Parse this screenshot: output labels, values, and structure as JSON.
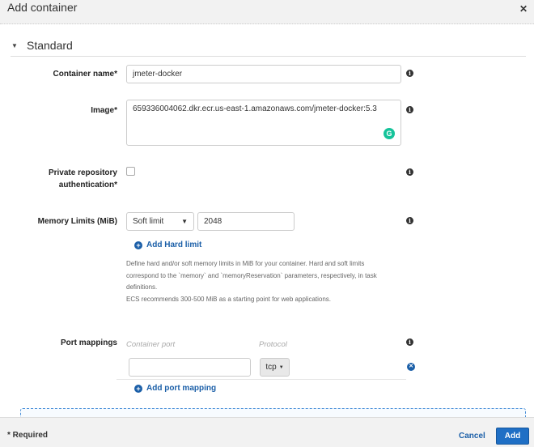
{
  "dialog": {
    "title": "Add container",
    "close_icon": "close-icon"
  },
  "section": {
    "title": "Standard"
  },
  "fields": {
    "container_name": {
      "label": "Container name*",
      "value": "jmeter-docker"
    },
    "image": {
      "label": "Image*",
      "value": "659336004062.dkr.ecr.us-east-1.amazonaws.com/jmeter-docker:5.3"
    },
    "private_repo": {
      "label_line1": "Private repository",
      "label_line2": "authentication*",
      "checked": false
    },
    "memory": {
      "label": "Memory Limits (MiB)",
      "limit_type": "Soft limit",
      "value": "2048",
      "add_hard_limit": "Add Hard limit",
      "help": [
        "Define hard and/or soft memory limits in MiB for your container. Hard and soft limits",
        "correspond to the `memory` and `memoryReservation` parameters, respectively, in task",
        "definitions.",
        "ECS recommends 300-500 MiB as a starting point for web applications."
      ]
    },
    "port_mappings": {
      "label": "Port mappings",
      "container_port_placeholder": "Container port",
      "protocol_placeholder": "Protocol",
      "container_port_value": "",
      "protocol": "tcp",
      "add_port_mapping": "Add port mapping"
    }
  },
  "footer": {
    "required_note": "* Required",
    "cancel": "Cancel",
    "add": "Add"
  },
  "colors": {
    "accent": "#1b5fa8",
    "add_button": "#1f6fc5",
    "grammarly": "#15c39a"
  }
}
